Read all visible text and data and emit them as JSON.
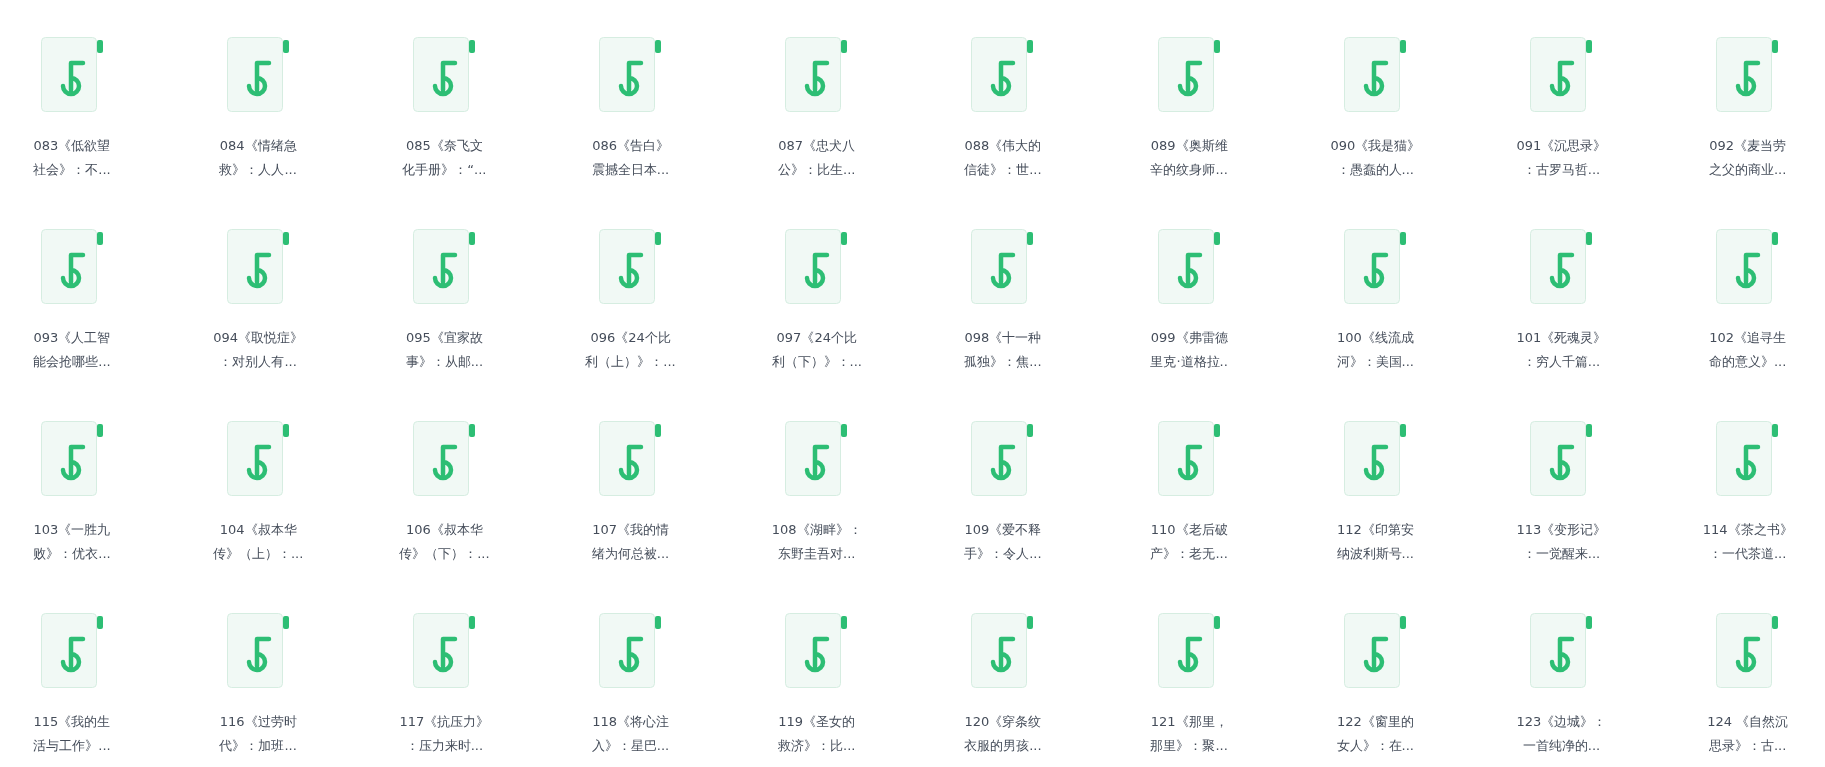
{
  "files": [
    {
      "lines": [
        "083《低欲望",
        "社会》：不..."
      ]
    },
    {
      "lines": [
        "084《情绪急",
        "救》：人人..."
      ]
    },
    {
      "lines": [
        "085《奈飞文",
        "化手册》：“..."
      ]
    },
    {
      "lines": [
        "086《告白》",
        "震撼全日本..."
      ]
    },
    {
      "lines": [
        "087《忠犬八",
        "公》：比生..."
      ]
    },
    {
      "lines": [
        "088《伟大的",
        "信徒》：世..."
      ]
    },
    {
      "lines": [
        "089《奥斯维",
        "辛的纹身师..."
      ]
    },
    {
      "lines": [
        "090《我是猫》",
        "：愚蠢的人..."
      ]
    },
    {
      "lines": [
        "091《沉思录》",
        "：古罗马哲..."
      ]
    },
    {
      "lines": [
        "092《麦当劳",
        "之父的商业..."
      ]
    },
    {
      "lines": [
        "093《人工智",
        "能会抢哪些..."
      ]
    },
    {
      "lines": [
        "094《取悦症》",
        "：对别人有..."
      ]
    },
    {
      "lines": [
        "095《宜家故",
        "事》：从邮..."
      ]
    },
    {
      "lines": [
        "096《24个比",
        "利（上）》：..."
      ]
    },
    {
      "lines": [
        "097《24个比",
        "利（下）》：..."
      ]
    },
    {
      "lines": [
        "098《十一种",
        "孤独》：焦..."
      ]
    },
    {
      "lines": [
        "099《弗雷德",
        "里克·道格拉.."
      ]
    },
    {
      "lines": [
        "100《线流成",
        "河》：美国..."
      ]
    },
    {
      "lines": [
        "101《死魂灵》",
        "：穷人千篇..."
      ]
    },
    {
      "lines": [
        "102《追寻生",
        "命的意义》..."
      ]
    },
    {
      "lines": [
        "103《一胜九",
        "败》：优衣..."
      ]
    },
    {
      "lines": [
        "104《叔本华",
        "传》（上）：..."
      ]
    },
    {
      "lines": [
        "106《叔本华",
        "传》（下）：..."
      ]
    },
    {
      "lines": [
        "107《我的情",
        "绪为何总被..."
      ]
    },
    {
      "lines": [
        "108《湖畔》：",
        "东野圭吾对..."
      ]
    },
    {
      "lines": [
        "109《爱不释",
        "手》：令人..."
      ]
    },
    {
      "lines": [
        "110《老后破",
        "产》：老无..."
      ]
    },
    {
      "lines": [
        "112《印第安",
        "纳波利斯号..."
      ]
    },
    {
      "lines": [
        "113《变形记》",
        "：一觉醒来..."
      ]
    },
    {
      "lines": [
        "114《茶之书》",
        "：一代茶道..."
      ]
    },
    {
      "lines": [
        "115《我的生",
        "活与工作》..."
      ]
    },
    {
      "lines": [
        "116《过劳时",
        "代》：加班..."
      ]
    },
    {
      "lines": [
        "117《抗压力》",
        "：压力来时..."
      ]
    },
    {
      "lines": [
        "118《将心注",
        "入》：星巴..."
      ]
    },
    {
      "lines": [
        "119《圣女的",
        "救济》：比..."
      ]
    },
    {
      "lines": [
        "120《穿条纹",
        "衣服的男孩..."
      ]
    },
    {
      "lines": [
        "121《那里，",
        "那里》：聚..."
      ]
    },
    {
      "lines": [
        "122《窗里的",
        "女人》：在..."
      ]
    },
    {
      "lines": [
        "123《边城》：",
        "一首纯净的..."
      ]
    },
    {
      "lines": [
        "124 《自然沉",
        "思录》：古..."
      ]
    }
  ]
}
